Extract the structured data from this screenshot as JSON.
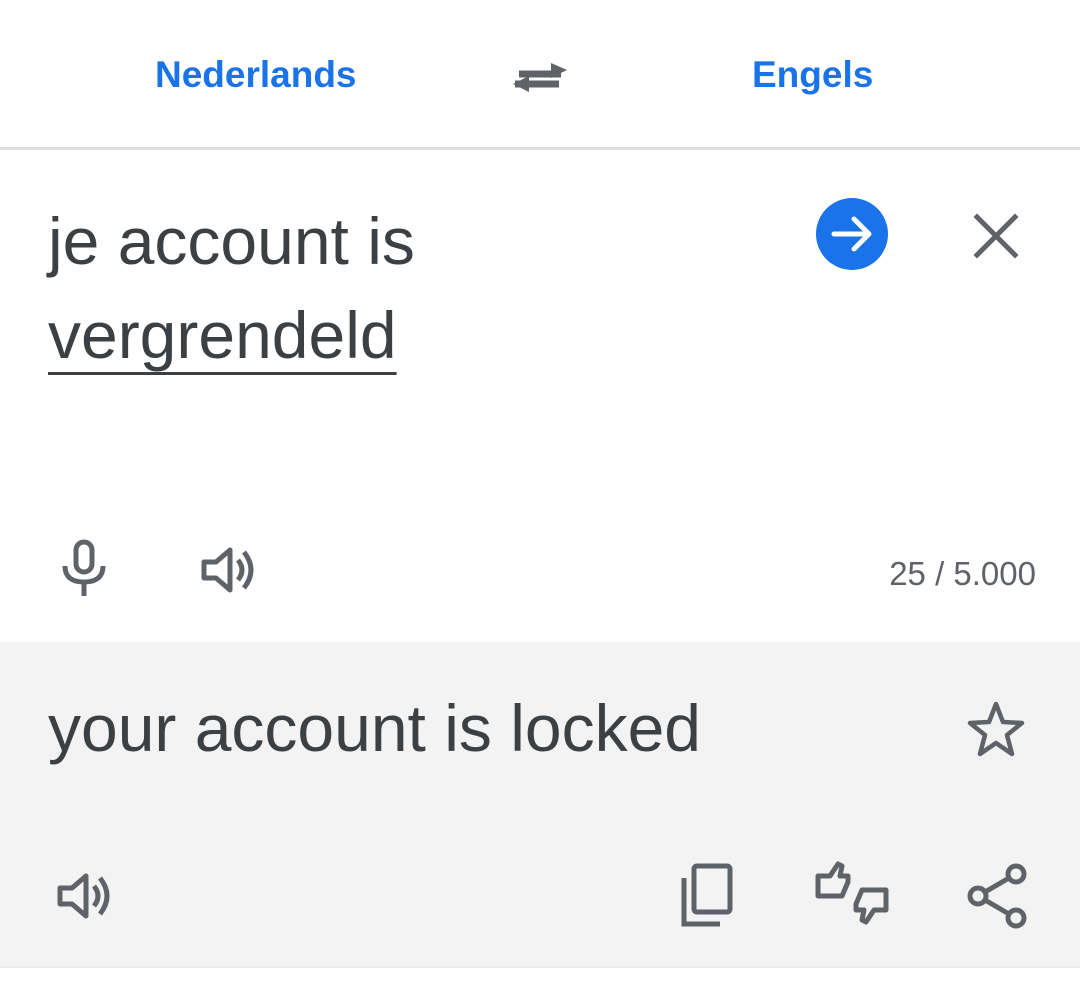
{
  "languages": {
    "source": "Nederlands",
    "target": "Engels",
    "swap_icon": "swap-horiz-icon"
  },
  "input": {
    "text_line1": "je account is",
    "text_line2": "vergrendeld",
    "char_count": "25 / 5.000",
    "go_icon": "arrow-forward-icon",
    "clear_icon": "close-icon",
    "mic_icon": "microphone-icon",
    "speak_icon": "volume-icon"
  },
  "output": {
    "text": "your account is locked",
    "star_icon": "star-outline-icon",
    "speak_icon": "volume-icon",
    "copy_icon": "copy-icon",
    "feedback_icon": "thumbs-up-down-icon",
    "share_icon": "share-icon"
  },
  "colors": {
    "accent": "#1a73e8",
    "text": "#3c4043",
    "icon": "#5f6368",
    "output_bg": "#f3f3f3",
    "divider": "#e0e0e0"
  }
}
